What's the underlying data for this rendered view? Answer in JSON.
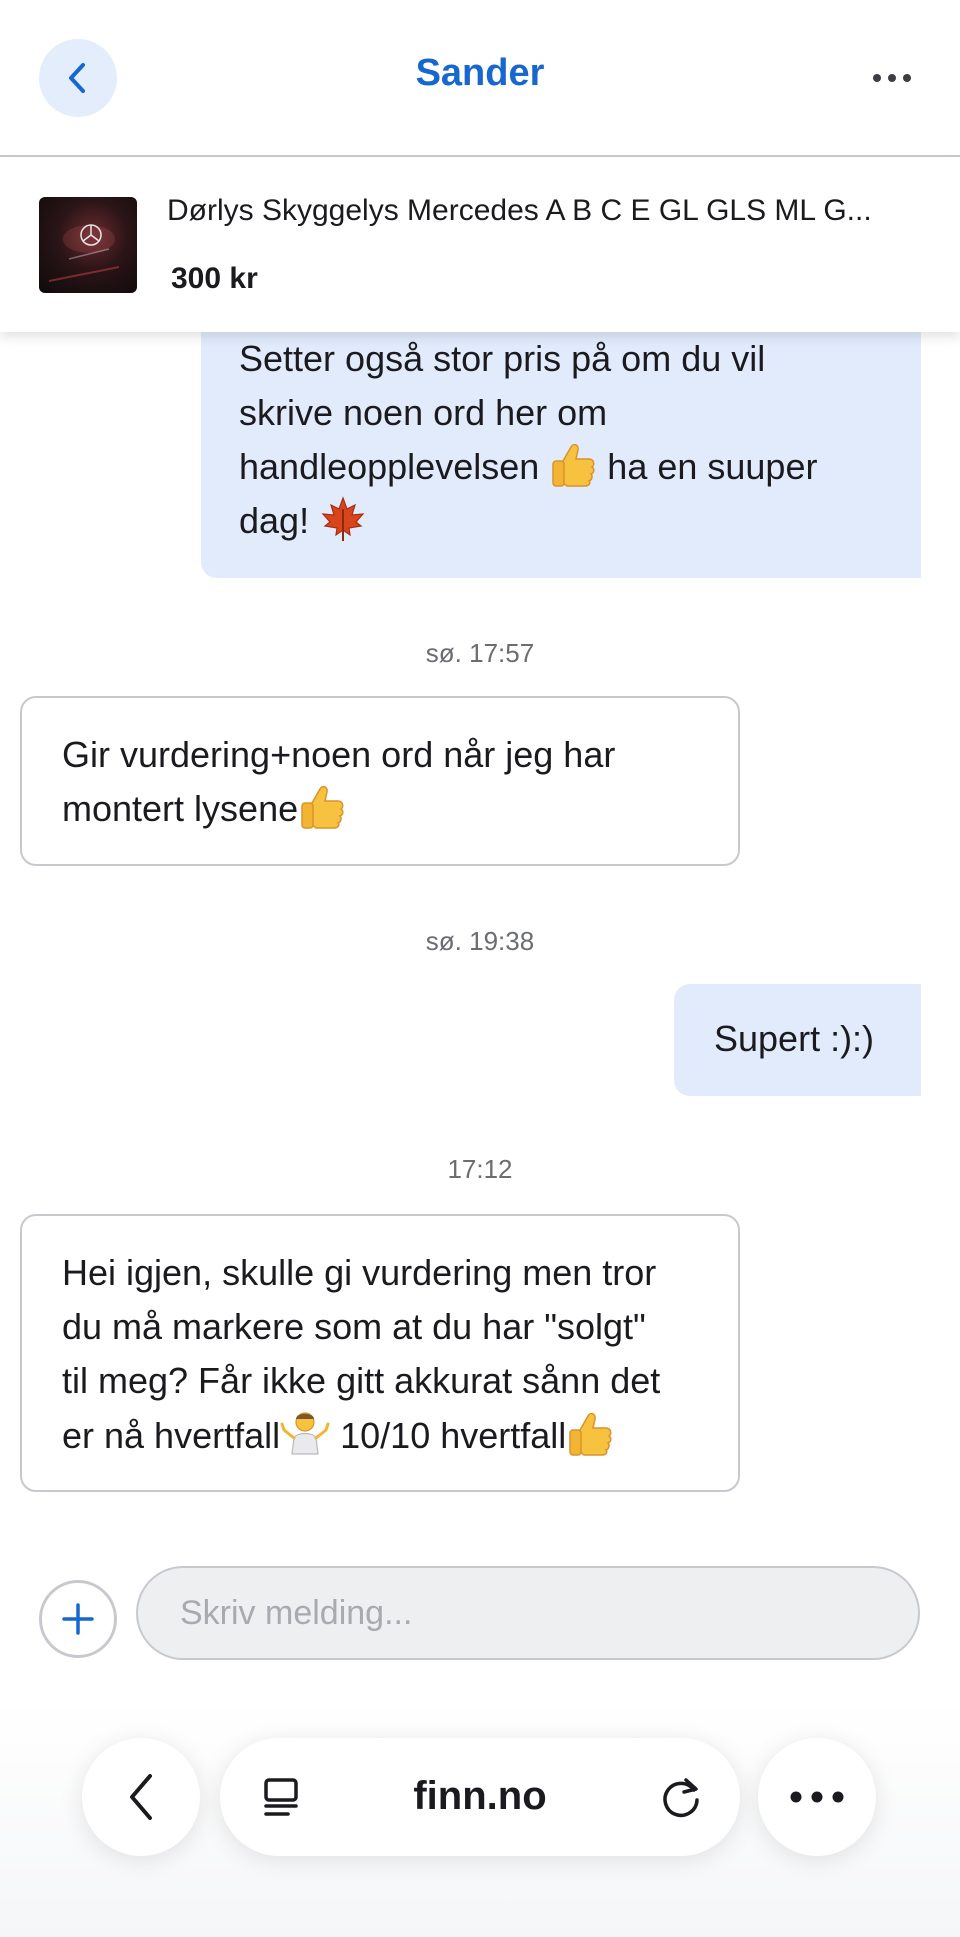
{
  "header": {
    "title": "Sander"
  },
  "listing": {
    "title": "Dørlys Skyggelys Mercedes A B C E GL GLS ML G...",
    "price": "300 kr"
  },
  "messages": [
    {
      "direction": "outgoing",
      "lines": [
        "Setter også stor pris på om du vil",
        "skrive noen ord her om",
        "handleopplevelsen",
        "ha en suuper",
        "dag!"
      ]
    },
    {
      "time": "sø. 17:57"
    },
    {
      "direction": "incoming",
      "lines": [
        "Gir vurdering+noen ord når jeg har",
        "montert lysene"
      ]
    },
    {
      "time": "sø. 19:38"
    },
    {
      "direction": "outgoing",
      "lines": [
        "Supert :):)"
      ]
    },
    {
      "time": "17:12"
    },
    {
      "direction": "incoming",
      "lines": [
        "Hei igjen, skulle gi vurdering men tror",
        "du må markere som at du har \"solgt\"",
        "til meg? Får ikke gitt akkurat sånn det",
        "er nå hvertfall",
        "10/10 hvertfall"
      ]
    }
  ],
  "composer": {
    "placeholder": "Skriv melding..."
  },
  "browser": {
    "url": "finn.no"
  },
  "colors": {
    "accent": "#1767ce",
    "outgoing_bubble": "#e1ebfc",
    "border": "#c8c9ce"
  }
}
